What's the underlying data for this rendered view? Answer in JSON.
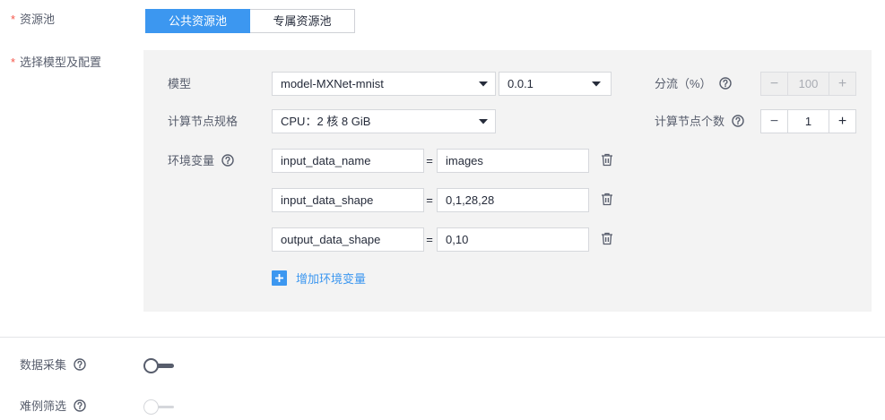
{
  "resource_pool": {
    "required_mark": "*",
    "label": "资源池",
    "options": [
      {
        "label": "公共资源池",
        "selected": true
      },
      {
        "label": "专属资源池",
        "selected": false
      }
    ]
  },
  "model_config": {
    "required_mark": "*",
    "label": "选择模型及配置",
    "model": {
      "label": "模型",
      "selected_model": "model-MXNet-mnist",
      "selected_version": "0.0.1"
    },
    "traffic": {
      "label": "分流（%）",
      "value": "100",
      "disabled": true,
      "decrement": "−",
      "increment": "+"
    },
    "spec": {
      "label": "计算节点规格",
      "selected": "CPU：2 核 8 GiB"
    },
    "instance_count": {
      "label": "计算节点个数",
      "value": "1",
      "disabled": false,
      "decrement": "−",
      "increment": "+"
    },
    "env": {
      "label": "环境变量",
      "separator": "=",
      "variables": [
        {
          "name": "input_data_name",
          "value": "images"
        },
        {
          "name": "input_data_shape",
          "value": "0,1,28,28"
        },
        {
          "name": "output_data_shape",
          "value": "0,10"
        }
      ],
      "add_label": "增加环境变量"
    }
  },
  "data_collection": {
    "label": "数据采集",
    "enabled": false,
    "disabled": false
  },
  "hard_example_filter": {
    "label": "难例筛选",
    "enabled": false,
    "disabled": true
  },
  "icons": {
    "help": "help-circle-icon",
    "dropdown": "caret-down-icon",
    "delete": "trash-icon",
    "add": "plus-square-icon"
  },
  "colors": {
    "accent": "#3c97f0",
    "required": "#f5564a",
    "panel_bg": "#f3f3f3",
    "label_text": "#575d6c",
    "value_text": "#252b3a"
  }
}
